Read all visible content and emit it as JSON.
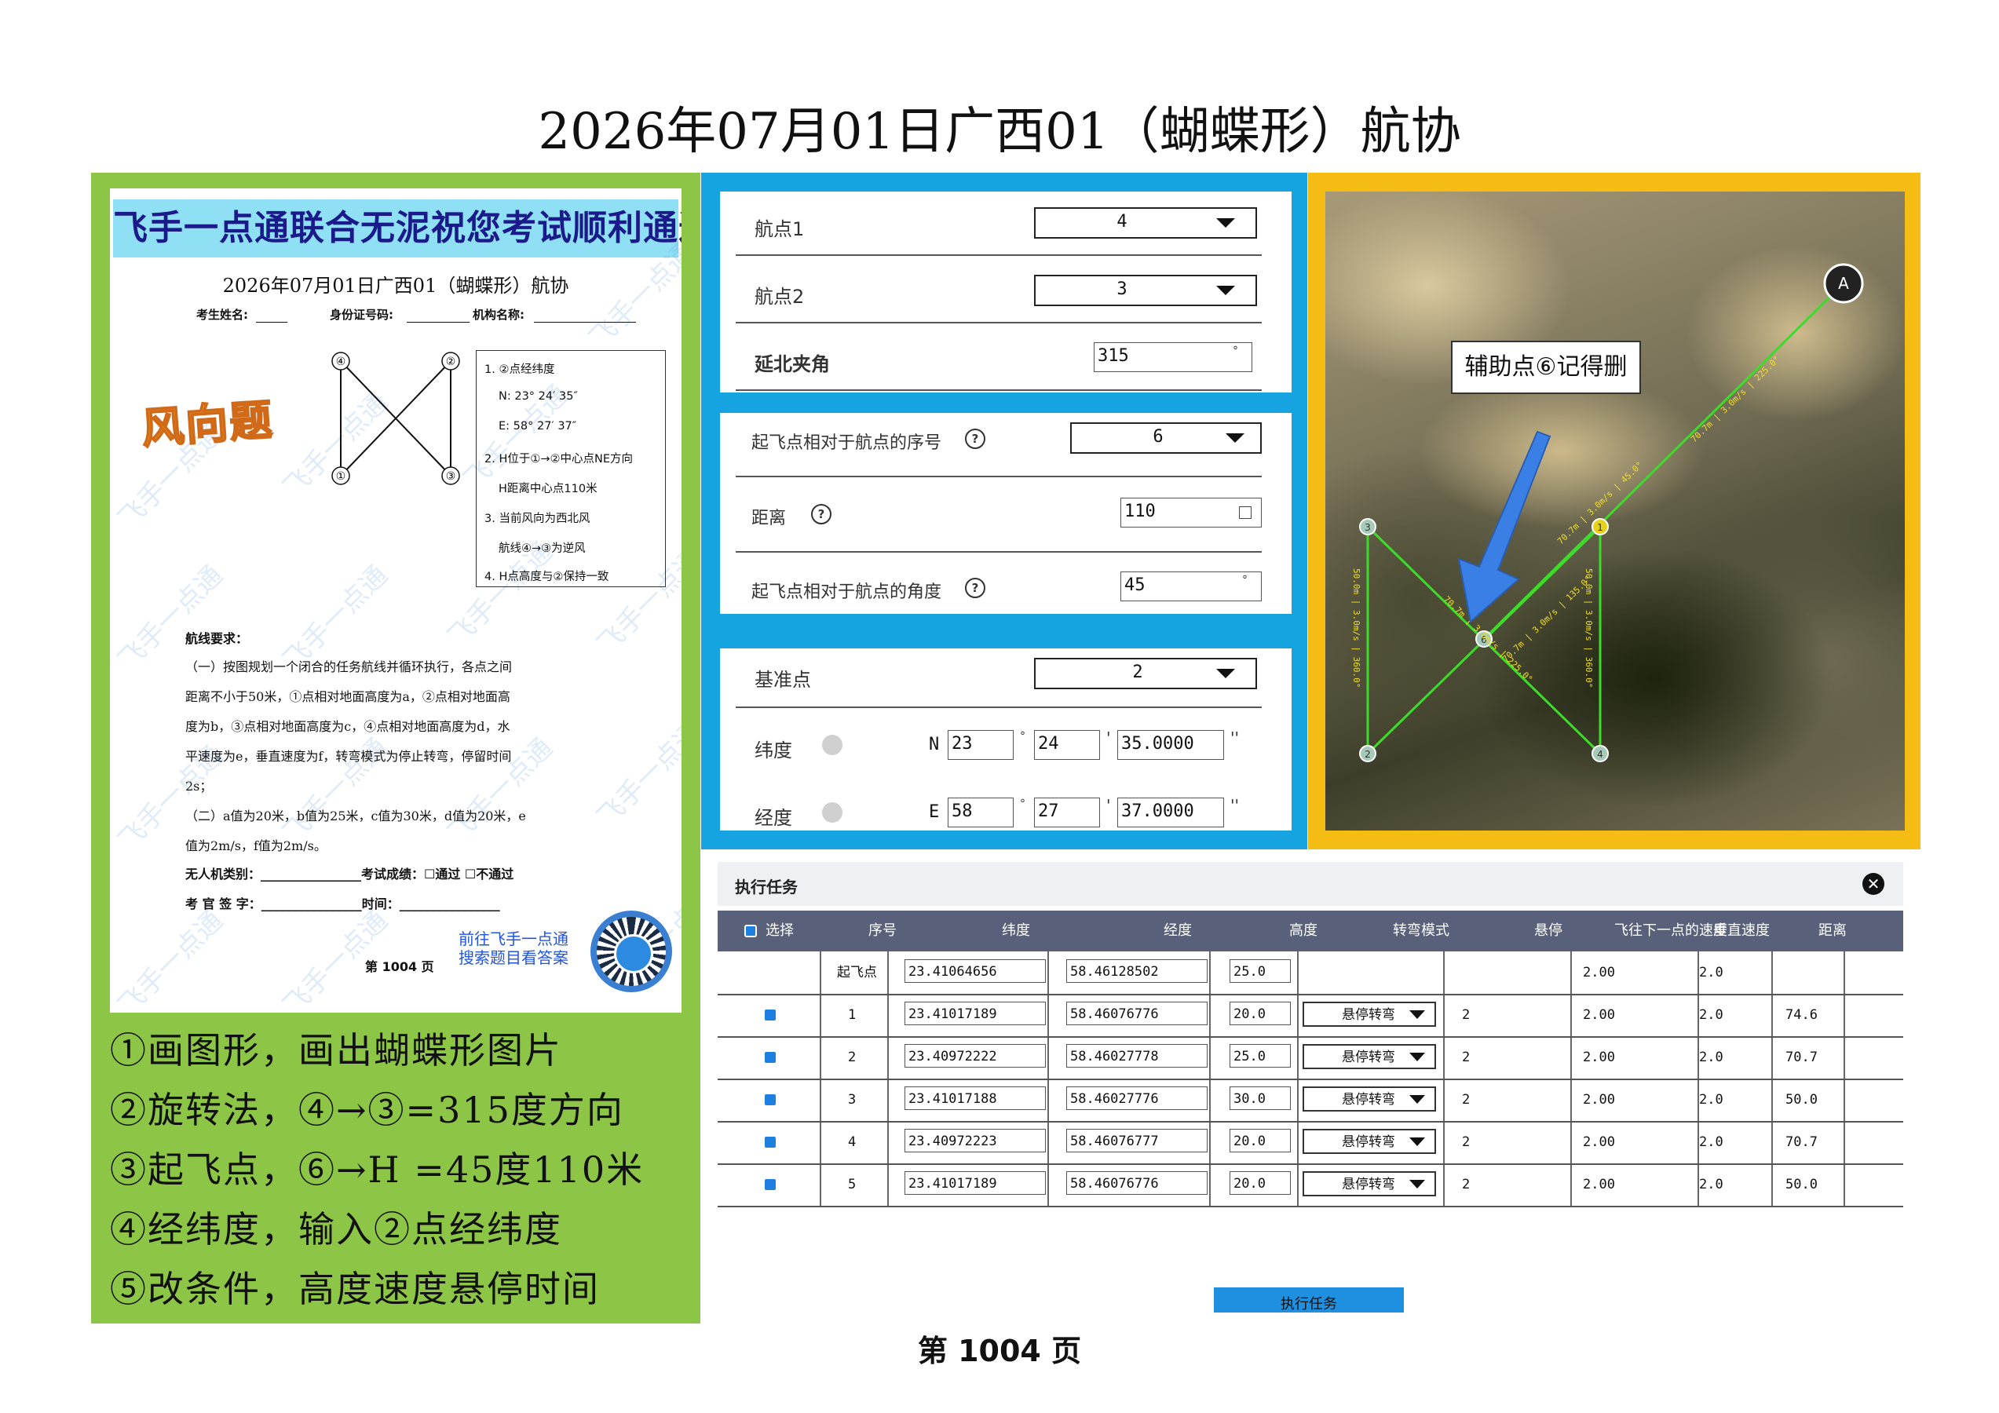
{
  "title": "2026年07月01日广西01（蝴蝶形）航协",
  "doc": {
    "banner": "飞手一点通联合无泥祝您考试顺利通过",
    "title": "2026年07月01日广西01（蝴蝶形）航协",
    "fields": {
      "name": "考生姓名:",
      "id": "身份证号码:",
      "org": "机构名称:"
    },
    "watermark": "飞手一点通",
    "wind_tag": "风向题",
    "points": [
      "④",
      "②",
      "①",
      "③"
    ],
    "conditions": [
      "1. ②点经纬度",
      "N: 23° 24′ 35″",
      "E: 58° 27′ 37″",
      "2. H位于①→②中心点NE方向",
      "H距离中心点110米",
      "3. 当前风向为西北风",
      "航线④→③为逆风",
      "4. H点高度与②保持一致"
    ],
    "route_head": "航线要求：",
    "route_lines": [
      "（一）按图规划一个闭合的任务航线并循环执行，各点之间",
      "距离不小于50米，①点相对地面高度为a，②点相对地面高",
      "度为b，③点相对地面高度为c，④点相对地面高度为d，水",
      "平速度为e，垂直速度为f，转弯模式为停止转弯，停留时间",
      "2s；",
      "（二）a值为20米，b值为25米，c值为30米，d值为20米，e",
      "值为2m/s，f值为2m/s。"
    ],
    "sig1": "无人机类别：________________考试成绩：☐通过 ☐不通过",
    "sig2": "考 官 签 字：________________时间：________________",
    "page": "第 1004 页",
    "qr_line1": "前往飞手一点通",
    "qr_line2": "搜索题目看答案"
  },
  "steps": [
    "①画图形，画出蝴蝶形图片",
    "②旋转法，④→③=315度方向",
    "③起飞点，⑥→H =45度110米",
    "④经纬度，输入②点经纬度",
    "⑤改条件，高度速度悬停时间"
  ],
  "form": {
    "wp1_label": "航点1",
    "wp1_value": "4",
    "wp2_label": "航点2",
    "wp2_value": "3",
    "angle_label": "延北夹角",
    "angle_value": "315",
    "degree": "°",
    "takeoff_seq_label": "起飞点相对于航点的序号",
    "takeoff_seq_value": "6",
    "distance_label": "距离",
    "distance_value": "110",
    "takeoff_angle_label": "起飞点相对于航点的角度",
    "takeoff_angle_value": "45",
    "help": "?",
    "ref_label": "基准点",
    "ref_value": "2",
    "lat_label": "纬度",
    "lat_prefix": "N",
    "lat_deg": "23",
    "lat_min": "24",
    "lat_sec": "35.0000",
    "lon_label": "经度",
    "lon_prefix": "E",
    "lon_deg": "58",
    "lon_min": "27",
    "lon_sec": "37.0000",
    "minute_mark": "'",
    "second_mark": "''"
  },
  "map": {
    "callout": "辅助点⑥记得删",
    "compass": "A",
    "nodes": [
      "1",
      "2",
      "3",
      "4",
      "5",
      "6"
    ],
    "labels": [
      "70.7m | 3.0m/s | 225.0°",
      "70.7m | 3.0m/s | 135.0°",
      "50.0m | 3.0m/s | 360.0°",
      "50.0m | 3.0m/s | 360.0°",
      "70.7m | 3.0m/s | 45.0°",
      "70.7m | 3.0m/s | 225.0°"
    ]
  },
  "task": {
    "title": "执行任务",
    "close": "✕",
    "columns": [
      "选择",
      "序号",
      "纬度",
      "经度",
      "高度",
      "转弯模式",
      "悬停",
      "飞往下一点的速度",
      "垂直速度",
      "距离"
    ],
    "rows": [
      {
        "seq": "起飞点",
        "lat": "23.41064656",
        "lon": "58.46128502",
        "alt": "25.0",
        "mode": "",
        "hover": "",
        "speed": "2.00",
        "vspeed": "2.0",
        "dist": ""
      },
      {
        "seq": "1",
        "lat": "23.41017189",
        "lon": "58.46076776",
        "alt": "20.0",
        "mode": "悬停转弯",
        "hover": "2",
        "speed": "2.00",
        "vspeed": "2.0",
        "dist": "74.6"
      },
      {
        "seq": "2",
        "lat": "23.40972222",
        "lon": "58.46027778",
        "alt": "25.0",
        "mode": "悬停转弯",
        "hover": "2",
        "speed": "2.00",
        "vspeed": "2.0",
        "dist": "70.7"
      },
      {
        "seq": "3",
        "lat": "23.41017188",
        "lon": "58.46027776",
        "alt": "30.0",
        "mode": "悬停转弯",
        "hover": "2",
        "speed": "2.00",
        "vspeed": "2.0",
        "dist": "50.0"
      },
      {
        "seq": "4",
        "lat": "23.40972223",
        "lon": "58.46076777",
        "alt": "20.0",
        "mode": "悬停转弯",
        "hover": "2",
        "speed": "2.00",
        "vspeed": "2.0",
        "dist": "70.7"
      },
      {
        "seq": "5",
        "lat": "23.41017189",
        "lon": "58.46076776",
        "alt": "20.0",
        "mode": "悬停转弯",
        "hover": "2",
        "speed": "2.00",
        "vspeed": "2.0",
        "dist": "50.0"
      }
    ],
    "execute": "执行任务"
  },
  "footer": "第 1004 页",
  "colors": {
    "green": "#8dc647",
    "blue": "#16a4e0",
    "orange": "#f5bd14",
    "table_head": "#59607a",
    "route": "#3ddc2a"
  }
}
